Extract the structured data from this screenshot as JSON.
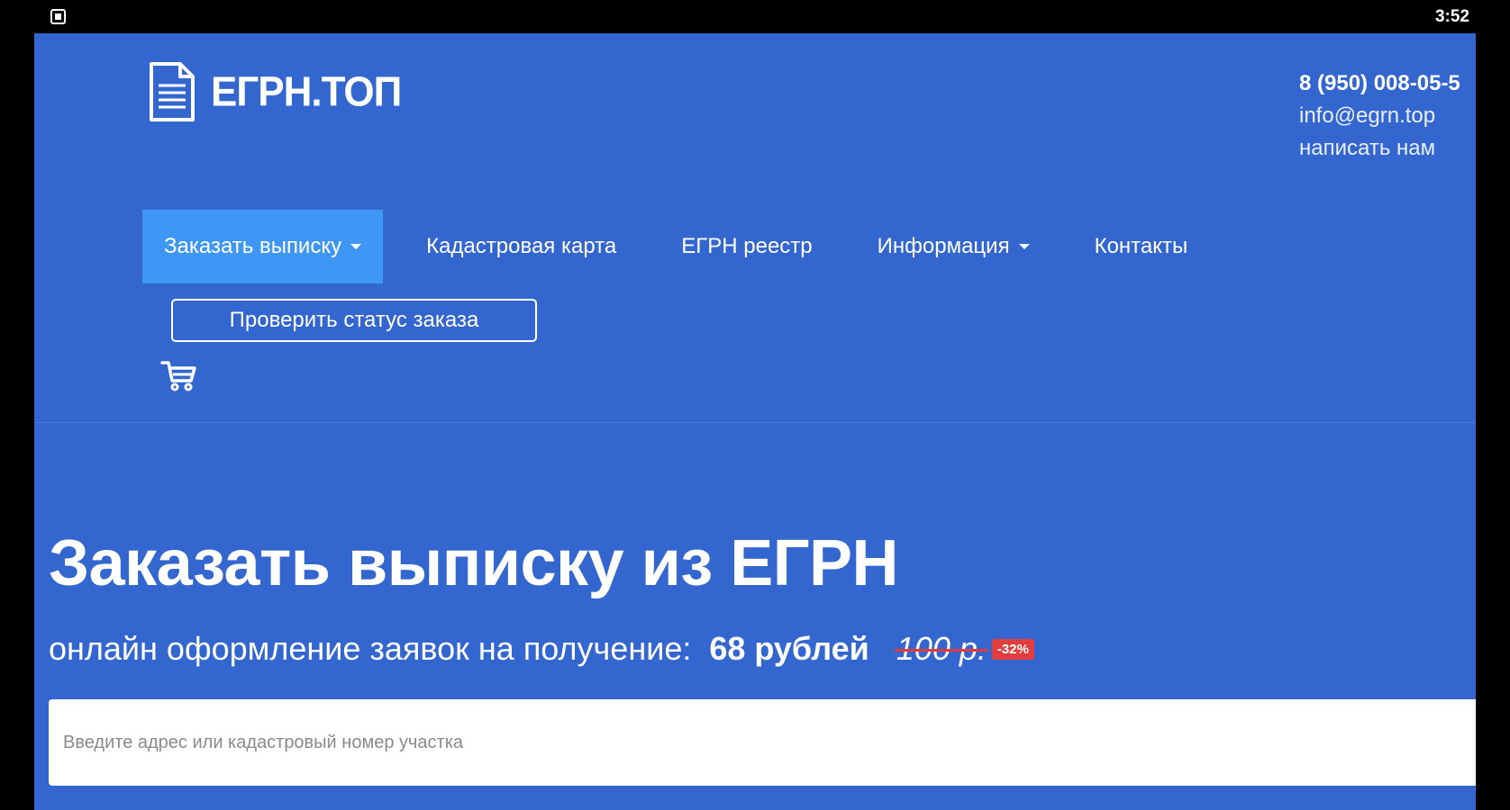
{
  "statusbar": {
    "time": "3:52",
    "app_icon": "screenshot-icon"
  },
  "header": {
    "logo_icon": "document-icon",
    "logo_text": "ЕГРН.ТОП",
    "contacts": {
      "phone": "8 (950) 008-05-5",
      "email": "info@egrn.top",
      "write": "написать нам"
    }
  },
  "nav": {
    "items": [
      {
        "label": "Заказать выписку",
        "dropdown": true,
        "active": true
      },
      {
        "label": "Кадастровая карта",
        "dropdown": false,
        "active": false
      },
      {
        "label": "ЕГРН реестр",
        "dropdown": false,
        "active": false
      },
      {
        "label": "Информация",
        "dropdown": true,
        "active": false
      },
      {
        "label": "Контакты",
        "dropdown": false,
        "active": false
      }
    ],
    "check_status_label": "Проверить статус заказа",
    "cart_icon": "cart-icon"
  },
  "hero": {
    "title": "Заказать выписку из ЕГРН",
    "subtitle": "онлайн оформление заявок на получение:",
    "price": "68 рублей",
    "old_price": "100 р.",
    "discount": "-32%"
  },
  "search": {
    "placeholder": "Введите адрес или кадастровый номер участка",
    "value": ""
  },
  "colors": {
    "background": "#3466d0",
    "nav_active": "#3f97f5",
    "discount": "#e33d3d"
  }
}
